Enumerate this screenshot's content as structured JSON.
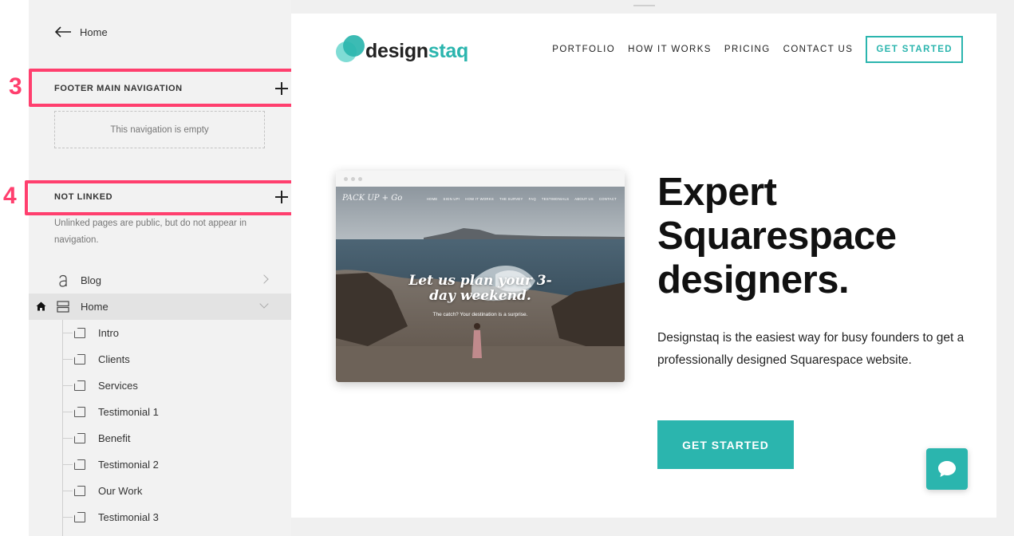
{
  "sidebar": {
    "back_label": "Home",
    "footer_nav": {
      "title": "FOOTER MAIN NAVIGATION",
      "empty_text": "This navigation is empty",
      "callout": "3"
    },
    "not_linked": {
      "title": "NOT LINKED",
      "note": "Unlinked pages are public, but do not appear in navigation.",
      "callout": "4"
    },
    "pages": [
      {
        "label": "Blog",
        "icon": "blog-icon"
      },
      {
        "label": "Home",
        "icon": "index-page-icon",
        "is_homepage": true,
        "expanded": true
      }
    ],
    "home_children": [
      {
        "label": "Intro"
      },
      {
        "label": "Clients"
      },
      {
        "label": "Services"
      },
      {
        "label": "Testimonial 1"
      },
      {
        "label": "Benefit"
      },
      {
        "label": "Testimonial 2"
      },
      {
        "label": "Our Work"
      },
      {
        "label": "Testimonial 3"
      }
    ]
  },
  "site": {
    "logo": {
      "part1": "design",
      "part2": "staq"
    },
    "nav": [
      "PORTFOLIO",
      "HOW IT WORKS",
      "PRICING",
      "CONTACT US"
    ],
    "nav_cta": "GET STARTED",
    "screenshot": {
      "brand": "PACK UP + Go",
      "nav": [
        "HOME",
        "SIGN UP!",
        "HOW IT WORKS",
        "THE SURVEY",
        "FAQ",
        "TESTIMONIALS",
        "ABOUT US",
        "CONTACT"
      ],
      "headline_1": "Let us plan your 3-",
      "headline_2": "day weekend.",
      "subline": "The catch? Your destination is a surprise."
    },
    "hero_title": "Expert Squarespace designers.",
    "hero_body": "Designstaq is the easiest way for busy founders to get a professionally designed Squarespace website.",
    "hero_cta": "GET STARTED"
  },
  "colors": {
    "accent": "#2bb5ae",
    "highlight": "#ff3f6e",
    "sidebar_bg": "#f2f2f2"
  }
}
